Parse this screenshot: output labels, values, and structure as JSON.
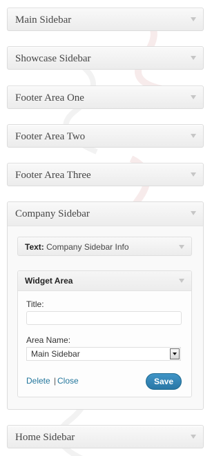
{
  "sidebars": [
    {
      "title": "Main Sidebar"
    },
    {
      "title": "Showcase Sidebar"
    },
    {
      "title": "Footer Area One"
    },
    {
      "title": "Footer Area Two"
    },
    {
      "title": "Footer Area Three"
    }
  ],
  "company": {
    "title": "Company Sidebar",
    "text_widget": {
      "type_label": "Text:",
      "name": "Company Sidebar Info"
    },
    "widget_area": {
      "title": "Widget Area",
      "title_label": "Title:",
      "title_value": "",
      "area_name_label": "Area Name:",
      "area_name_value": "Main Sidebar",
      "delete_label": "Delete",
      "separator": "|",
      "close_label": "Close",
      "save_label": "Save"
    }
  },
  "home": {
    "title": "Home Sidebar"
  },
  "colors": {
    "link": "#21759b",
    "save_button": "#2a77a6"
  }
}
